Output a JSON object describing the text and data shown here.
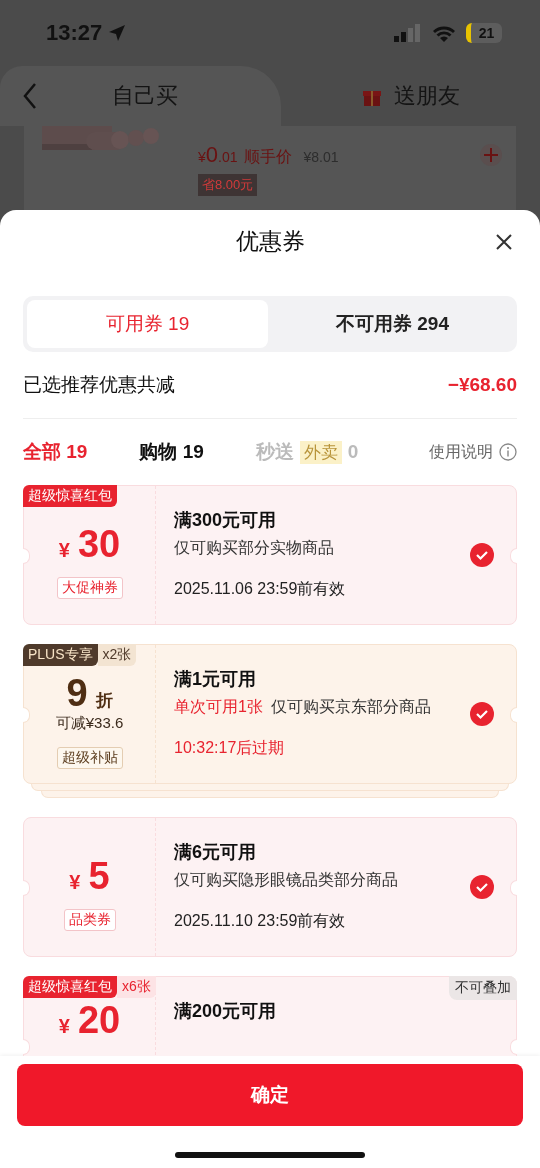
{
  "status_bar": {
    "time": "13:27",
    "battery": "21"
  },
  "header": {
    "tabs": [
      {
        "label": "自己买",
        "selected": true
      },
      {
        "label": "送朋友",
        "selected": false
      }
    ]
  },
  "product": {
    "price_symbol": "¥",
    "price_int": "0",
    "price_dec": ".01",
    "price_label": "顺手价",
    "original_price": "¥8.01",
    "saving": "省8.00元"
  },
  "sheet": {
    "title": "优惠券",
    "segments": [
      {
        "label": "可用券 19",
        "selected": true
      },
      {
        "label": "不可用券 294",
        "selected": false
      }
    ],
    "summary": {
      "label": "已选推荐优惠共减",
      "amount": "−¥68.60"
    },
    "filters": [
      {
        "label": "全部 19",
        "selected": true,
        "disabled": false
      },
      {
        "label": "购物 19",
        "selected": false,
        "disabled": false
      },
      {
        "label": "秒送",
        "tag": "外卖",
        "count": "0",
        "selected": false,
        "disabled": true
      }
    ],
    "help": "使用说明",
    "coupons": [
      {
        "kind": "cash",
        "badge": "超级惊喜红包",
        "currency": "¥",
        "amount": "30",
        "label": "大促神券",
        "title": "满300元可用",
        "desc": "仅可购买部分实物商品",
        "expiry": "2025.11.06 23:59前有效",
        "expiry_urgent": false,
        "checked": true
      },
      {
        "kind": "discount",
        "badge": "PLUS专享",
        "count": "x2张",
        "stacked": true,
        "amount": "9",
        "unit": "折",
        "sub": "可减¥33.6",
        "label": "超级补贴",
        "title": "满1元可用",
        "limit": "单次可用1张",
        "desc": "仅可购买京东部分商品",
        "expiry": "10:32:17后过期",
        "expiry_urgent": true,
        "checked": true
      },
      {
        "kind": "cash",
        "currency": "¥",
        "amount": "5",
        "label": "品类券",
        "title": "满6元可用",
        "desc": "仅可购买隐形眼镜品类部分商品",
        "expiry": "2025.11.10 23:59前有效",
        "expiry_urgent": false,
        "checked": true
      },
      {
        "kind": "cash",
        "badge": "超级惊喜红包",
        "count": "x6张",
        "note": "不可叠加",
        "currency": "¥",
        "amount": "20",
        "title": "满200元可用"
      }
    ],
    "confirm": "确定"
  }
}
